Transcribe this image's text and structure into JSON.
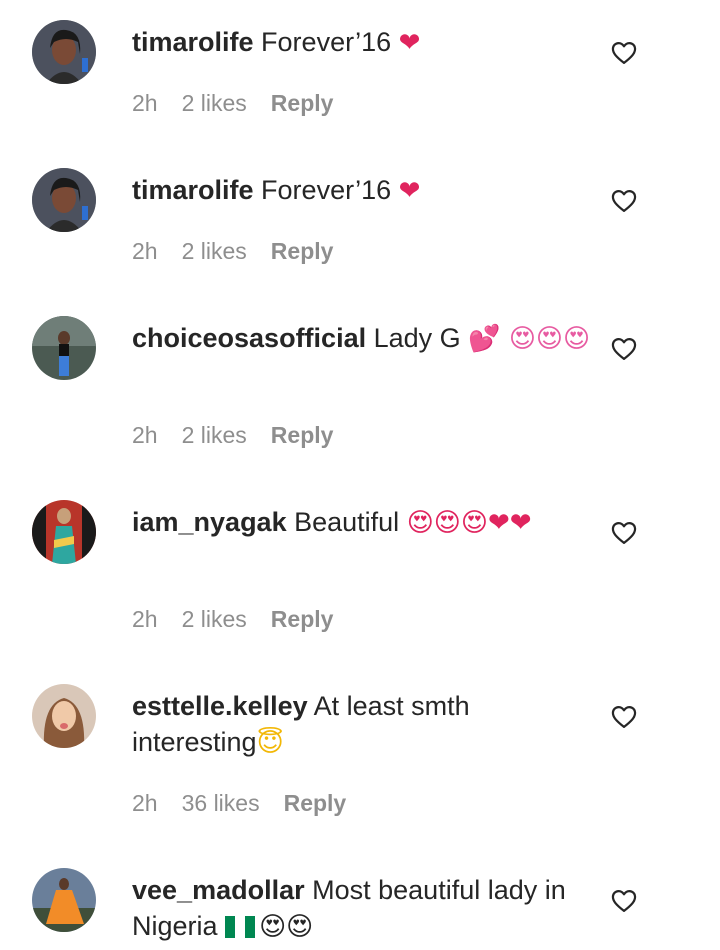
{
  "colors": {
    "text": "#262626",
    "meta": "#8e8e8e",
    "background": "#ffffff"
  },
  "comments": [
    {
      "username": "timarolife",
      "text": "Forever’16",
      "emoji": "❤",
      "time": "2h",
      "likes": "2 likes",
      "reply": "Reply",
      "like_icon": "heart-outline-icon"
    },
    {
      "username": "timarolife",
      "text": "Forever’16",
      "emoji": "❤",
      "time": "2h",
      "likes": "2 likes",
      "reply": "Reply",
      "like_icon": "heart-outline-icon"
    },
    {
      "username": "choiceosasofficial",
      "text": "Lady G",
      "emoji": "💕 😍😍😍",
      "time": "2h",
      "likes": "2 likes",
      "reply": "Reply",
      "like_icon": "heart-outline-icon"
    },
    {
      "username": "iam_nyagak",
      "text": "Beautiful",
      "emoji": "😍😍😍❤❤",
      "time": "2h",
      "likes": "2 likes",
      "reply": "Reply",
      "like_icon": "heart-outline-icon"
    },
    {
      "username": "esttelle.kelley",
      "text": "At least smth interesting",
      "emoji": "😇",
      "time": "2h",
      "likes": "36 likes",
      "reply": "Reply",
      "like_icon": "heart-outline-icon"
    },
    {
      "username": "vee_madollar",
      "text": "Most beautiful lady in Nigeria",
      "emoji": "😍😍",
      "flag": "nigeria-flag-icon",
      "like_icon": "heart-outline-icon"
    }
  ]
}
